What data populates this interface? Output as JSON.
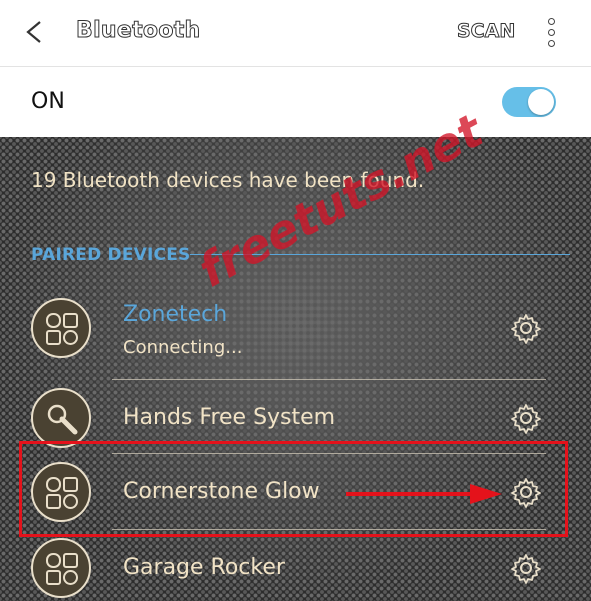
{
  "header": {
    "title": "Bluetooth",
    "scan_label": "SCAN"
  },
  "toggle_row": {
    "label": "ON",
    "enabled": true
  },
  "status_text": "19 Bluetooth devices have been found.",
  "section_header": "PAIRED DEVICES",
  "devices": [
    {
      "name": "Zonetech",
      "status": "Connecting...",
      "icon": "device-icon"
    },
    {
      "name": "Hands Free System",
      "status": "",
      "icon": "headset-icon"
    },
    {
      "name": "Cornerstone Glow",
      "status": "",
      "icon": "device-icon"
    },
    {
      "name": "Garage Rocker",
      "status": "",
      "icon": "device-icon"
    }
  ],
  "watermark": "freetuts.net",
  "colors": {
    "accent": "#5aa6da",
    "toggle_on": "#66bfe8",
    "highlight": "#e4121b"
  }
}
